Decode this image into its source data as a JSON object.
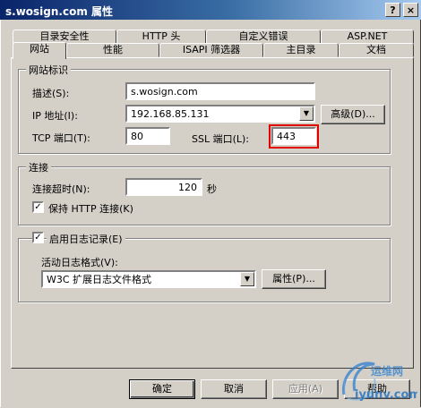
{
  "window": {
    "title": "s.wosign.com 属性",
    "help_button": "?",
    "close_button": "×"
  },
  "tabs": {
    "row1": [
      "目录安全性",
      "HTTP 头",
      "自定义错误",
      "ASP.NET"
    ],
    "row2": [
      "网站",
      "性能",
      "ISAPI 筛选器",
      "主目录",
      "文档"
    ],
    "active": "网站"
  },
  "website_id": {
    "group_title": "网站标识",
    "description_label": "描述(S):",
    "description_value": "s.wosign.com",
    "ip_label": "IP 地址(I):",
    "ip_value": "192.168.85.131",
    "advanced_button": "高级(D)...",
    "tcp_label": "TCP 端口(T):",
    "tcp_value": "80",
    "ssl_label": "SSL 端口(L):",
    "ssl_value": "443"
  },
  "connection": {
    "group_title": "连接",
    "timeout_label": "连接超时(N):",
    "timeout_value": "120",
    "timeout_unit": "秒",
    "keepalive_label": "保持 HTTP 连接(K)",
    "keepalive_checked": true
  },
  "logging": {
    "enable_label": "启用日志记录(E)",
    "enable_checked": true,
    "format_label": "活动日志格式(V):",
    "format_value": "W3C 扩展日志文件格式",
    "properties_button": "属性(P)..."
  },
  "footer": {
    "ok": "确定",
    "cancel": "取消",
    "apply": "应用(A)",
    "help": "帮助"
  },
  "watermark": {
    "line1": "运维网",
    "line2": "iyunv.com"
  },
  "colors": {
    "highlight_box": "#e00000",
    "titlebar": "#0a246a",
    "face": "#d4d0c8"
  }
}
